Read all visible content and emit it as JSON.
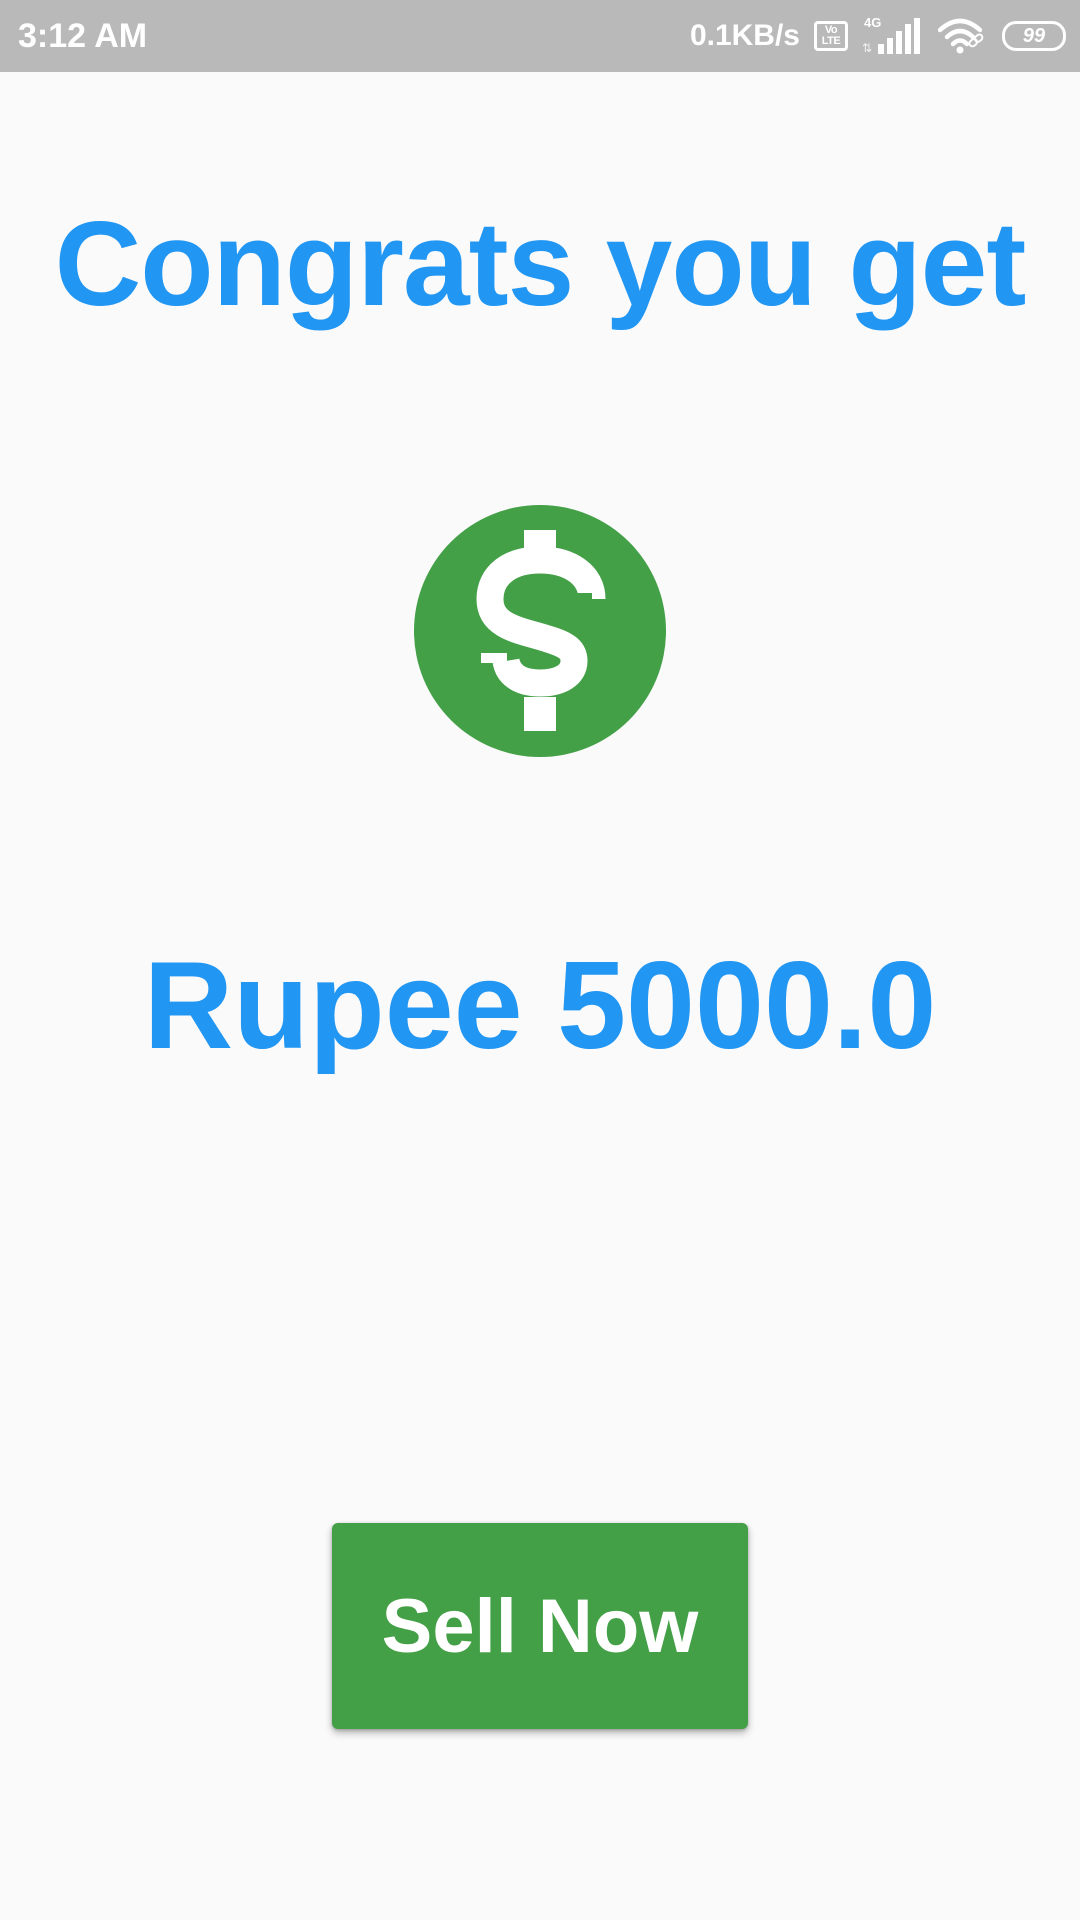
{
  "status_bar": {
    "time": "3:12 AM",
    "net_speed": "0.1KB/s",
    "volte_line1": "Vo",
    "volte_line2": "LTE",
    "network_type": "4G",
    "battery_level": "99",
    "icons": [
      "volte-icon",
      "cell-signal-icon",
      "wifi-icon",
      "battery-icon"
    ]
  },
  "main": {
    "title": "Congrats you get",
    "icon": "dollar-coin-icon",
    "amount_text": "Rupee 5000.0",
    "sell_button_label": "Sell Now"
  },
  "colors": {
    "accent_blue": "#2196f3",
    "green": "#43a047",
    "status_bar_bg": "#b9b9b9",
    "background": "#fafafa"
  }
}
